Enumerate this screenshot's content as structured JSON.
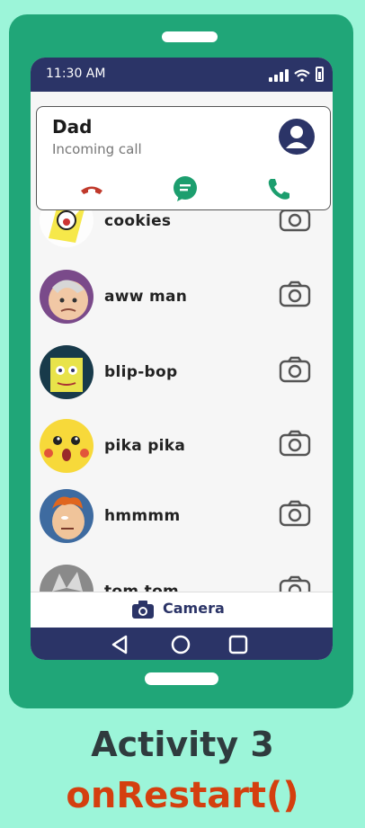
{
  "status_bar": {
    "time": "11:30 AM"
  },
  "incoming_call": {
    "caller": "Dad",
    "subtitle": "Incoming call",
    "colors": {
      "decline": "#c0392b",
      "message": "#1c9e6e",
      "accept": "#1c9e6e"
    }
  },
  "contacts": [
    {
      "name": "cookies",
      "avatar": "meme-avatar-yellow"
    },
    {
      "name": "aww man",
      "avatar": "meme-avatar-face"
    },
    {
      "name": "blip-bop",
      "avatar": "meme-avatar-sponge"
    },
    {
      "name": "pika pika",
      "avatar": "meme-avatar-pika"
    },
    {
      "name": "hmmmm",
      "avatar": "meme-avatar-fry"
    },
    {
      "name": "tom tom",
      "avatar": "meme-avatar-cat"
    }
  ],
  "bottom_bar": {
    "label": "Camera"
  },
  "caption": {
    "line1": "Activity 3",
    "line2": "onRestart()"
  },
  "colors": {
    "phone": "#20a678",
    "screen_bar": "#2b3467",
    "background": "#9cf5d9",
    "caption_accent": "#d43f0f"
  }
}
